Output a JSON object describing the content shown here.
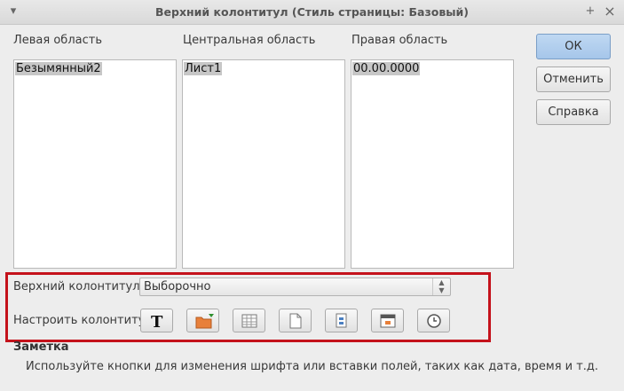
{
  "window": {
    "title": "Верхний колонтитул (Стиль страницы: Базовый)",
    "menu_glyph": "▾",
    "pin_glyph": "+",
    "close_glyph": "×"
  },
  "areas": {
    "left": {
      "label": "Левая область",
      "content": "Безымянный2"
    },
    "center": {
      "label": "Центральная область",
      "content": "Лист1"
    },
    "right": {
      "label": "Правая область",
      "content": "00.00.0000"
    }
  },
  "buttons": {
    "ok": "ОК",
    "cancel": "Отменить",
    "help": "Справка"
  },
  "header_row": {
    "label": "Верхний колонтитул",
    "value": "Выборочно"
  },
  "customize_row": {
    "label": "Настроить колонтитул",
    "icons": [
      "text-attributes-icon",
      "file-name-icon",
      "sheet-name-icon",
      "page-icon",
      "pages-icon",
      "date-icon",
      "time-icon"
    ]
  },
  "note": {
    "title": "Заметка",
    "text": "Используйте кнопки для изменения шрифта или вставки полей, таких как дата, время и т.д."
  },
  "colors": {
    "highlight_box": "#c4121b",
    "ok_button": "#a6c6ea",
    "selection": "#c7c7c7"
  }
}
